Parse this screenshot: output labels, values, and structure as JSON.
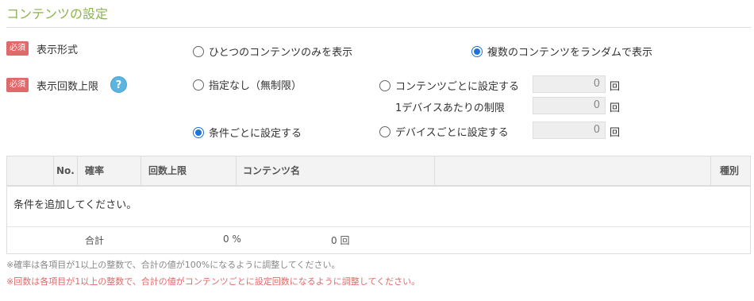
{
  "section": {
    "title": "コンテンツの設定"
  },
  "required_badge": "必須",
  "display_format": {
    "label": "表示形式",
    "options": [
      "ひとつのコンテンツのみを表示",
      "複数のコンテンツをランダムで表示"
    ],
    "selected_index": 1
  },
  "display_limit": {
    "label": "表示回数上限",
    "help_icon": "?",
    "option_none": "指定なし（無制限）",
    "option_per_condition": "条件ごとに設定する",
    "option_per_content": "コンテンツごとに設定する",
    "per_device_label": "1デバイスあたりの制限",
    "option_per_device": "デバイスごとに設定する",
    "selected": "per_condition",
    "per_content_value": "0",
    "per_device_limit_value": "0",
    "per_device_value": "0",
    "unit": "回"
  },
  "table": {
    "headers": {
      "no": "No.",
      "probability": "確率",
      "limit": "回数上限",
      "content_name": "コンテンツ名",
      "type": "種別"
    },
    "empty_message": "条件を追加してください。",
    "totals": {
      "label": "合計",
      "percent": "0 %",
      "count": "0 回"
    }
  },
  "notes": {
    "probability": "※確率は各項目が1以上の整数で、合計の値が100%になるように調整してください。",
    "count": "※回数は各項目が1以上の整数で、合計の値がコンテンツごとに設定回数になるように調整してください。"
  },
  "colors": {
    "title": "#8bb34a",
    "badge": "#e06a6a",
    "radio_selected": "#1e73d6",
    "help_icon": "#5bb5e0",
    "warning_note": "#e06a6a"
  }
}
